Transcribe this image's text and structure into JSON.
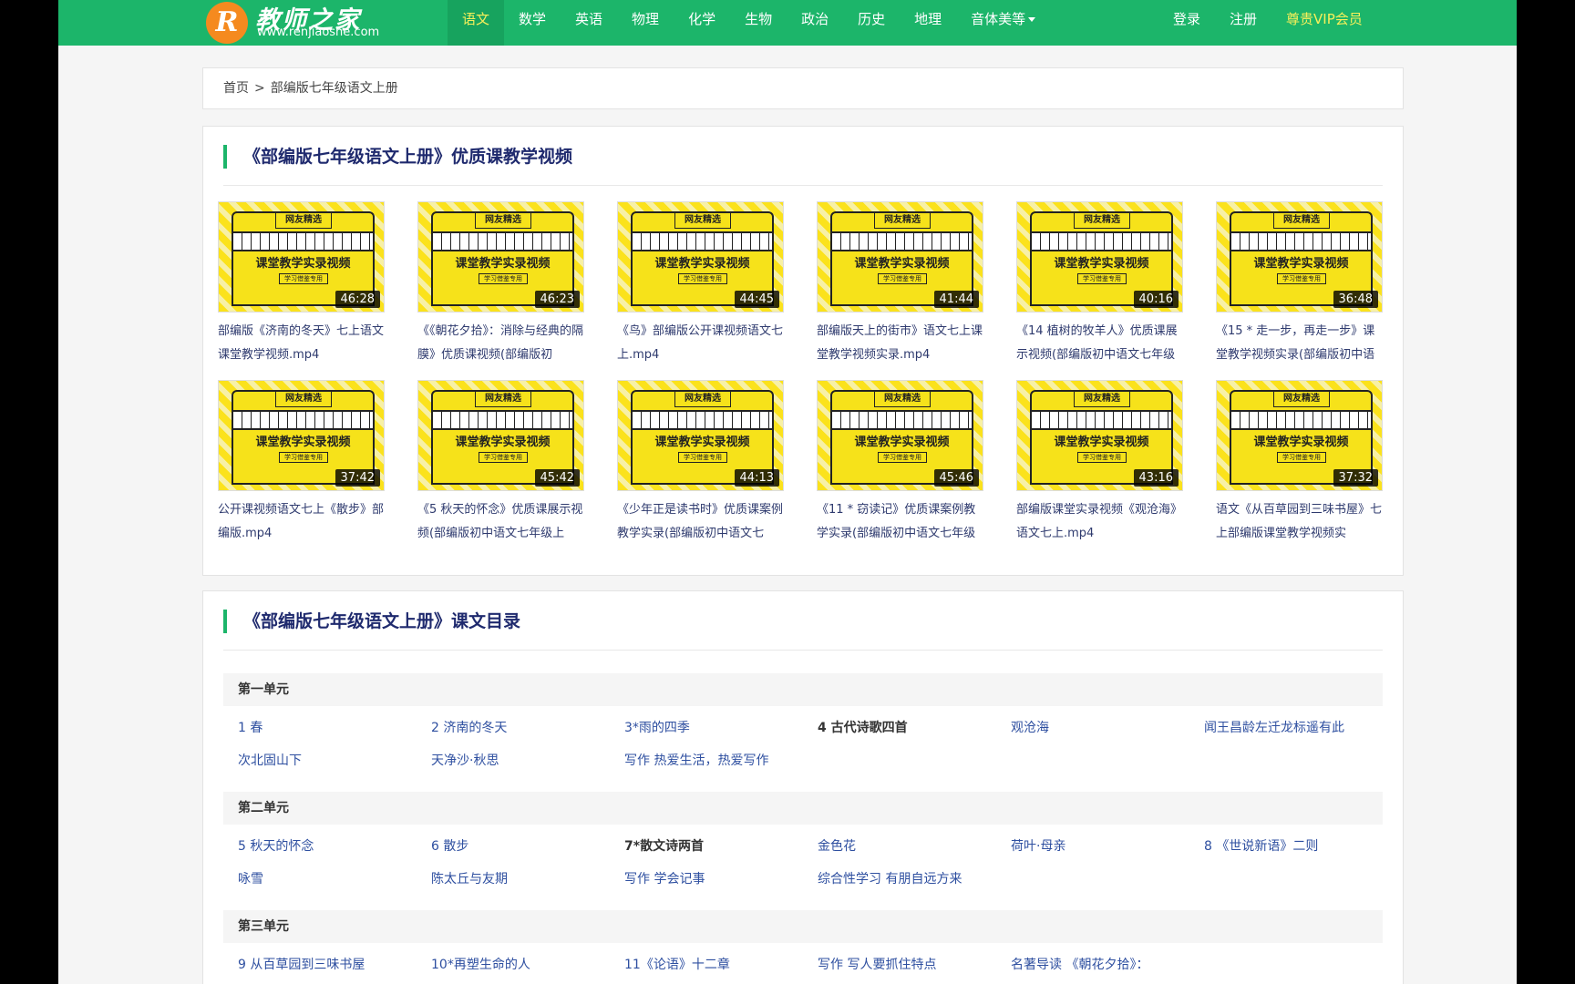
{
  "nav": {
    "logo_mark": "R",
    "logo_title": "教师之家",
    "logo_url": "www.renjiaoshe.com",
    "links": [
      "语文",
      "数学",
      "英语",
      "物理",
      "化学",
      "生物",
      "政治",
      "历史",
      "地理",
      "音体美等"
    ],
    "login": "登录",
    "register": "注册",
    "vip": "尊贵VIP会员"
  },
  "breadcrumb": {
    "home": "首页",
    "sep": ">",
    "current": "部编版七年级语文上册"
  },
  "videos": {
    "title": "《部编版七年级语文上册》优质课教学视频",
    "thumb_tag": "网友精选",
    "thumb_sign": "课堂教学实录视频",
    "thumb_small": "学习借鉴专用",
    "items": [
      {
        "duration": "46:28",
        "title": "部编版《济南的冬天》七上语文课堂教学视频.mp4"
      },
      {
        "duration": "46:23",
        "title": "《《朝花夕拾》：消除与经典的隔膜》优质课视频(部编版初"
      },
      {
        "duration": "44:45",
        "title": "《鸟》部编版公开课视频语文七上.mp4"
      },
      {
        "duration": "41:44",
        "title": "部编版天上的街市》语文七上课堂教学视频实录.mp4"
      },
      {
        "duration": "40:16",
        "title": "《14 植树的牧羊人》优质课展示视频(部编版初中语文七年级"
      },
      {
        "duration": "36:48",
        "title": "《15 * 走一步，再走一步》课堂教学视频实录(部编版初中语"
      },
      {
        "duration": "37:42",
        "title": "公开课视频语文七上《散步》部编版.mp4"
      },
      {
        "duration": "45:42",
        "title": "《5 秋天的怀念》优质课展示视频(部编版初中语文七年级上"
      },
      {
        "duration": "44:13",
        "title": "《少年正是读书时》优质课案例教学实录(部编版初中语文七"
      },
      {
        "duration": "45:46",
        "title": "《11 * 窃读记》优质课案例教学实录(部编版初中语文七年级"
      },
      {
        "duration": "43:16",
        "title": "部编版课堂实录视频《观沧海》语文七上.mp4"
      },
      {
        "duration": "37:32",
        "title": "语文《从百草园到三味书屋》七上部编版课堂教学视频实"
      }
    ]
  },
  "toc": {
    "title": "《部编版七年级语文上册》课文目录",
    "units": [
      {
        "name": "第一单元",
        "rows": [
          [
            {
              "t": "1 春",
              "b": false
            },
            {
              "t": "2 济南的冬天",
              "b": false
            },
            {
              "t": "3*雨的四季",
              "b": false
            },
            {
              "t": "4 古代诗歌四首",
              "b": true
            },
            {
              "t": "观沧海",
              "b": false
            },
            {
              "t": "闻王昌龄左迁龙标遥有此",
              "b": false
            }
          ],
          [
            {
              "t": "次北固山下",
              "b": false
            },
            {
              "t": "天净沙·秋思",
              "b": false
            },
            {
              "t": "写作 热爱生活，热爱写作",
              "b": false
            }
          ]
        ]
      },
      {
        "name": "第二单元",
        "rows": [
          [
            {
              "t": "5 秋天的怀念",
              "b": false
            },
            {
              "t": "6 散步",
              "b": false
            },
            {
              "t": "7*散文诗两首",
              "b": true
            },
            {
              "t": "金色花",
              "b": false
            },
            {
              "t": "荷叶·母亲",
              "b": false
            },
            {
              "t": "8 《世说新语》二则",
              "b": false
            }
          ],
          [
            {
              "t": "咏雪",
              "b": false
            },
            {
              "t": "陈太丘与友期",
              "b": false
            },
            {
              "t": "写作 学会记事",
              "b": false
            },
            {
              "t": "综合性学习 有朋自远方来",
              "b": false
            }
          ]
        ]
      },
      {
        "name": "第三单元",
        "rows": [
          [
            {
              "t": "9 从百草园到三味书屋",
              "b": false
            },
            {
              "t": "10*再塑生命的人",
              "b": false
            },
            {
              "t": "11《论语》十二章",
              "b": false
            },
            {
              "t": "写作 写人要抓住特点",
              "b": false
            },
            {
              "t": "名著导读 《朝花夕拾》：",
              "b": false
            }
          ]
        ]
      }
    ]
  },
  "colors": {
    "nav_bg": "#1cb56a",
    "accent": "#1cb56a",
    "vip": "#f6f05a",
    "link": "#2e4fa0"
  }
}
